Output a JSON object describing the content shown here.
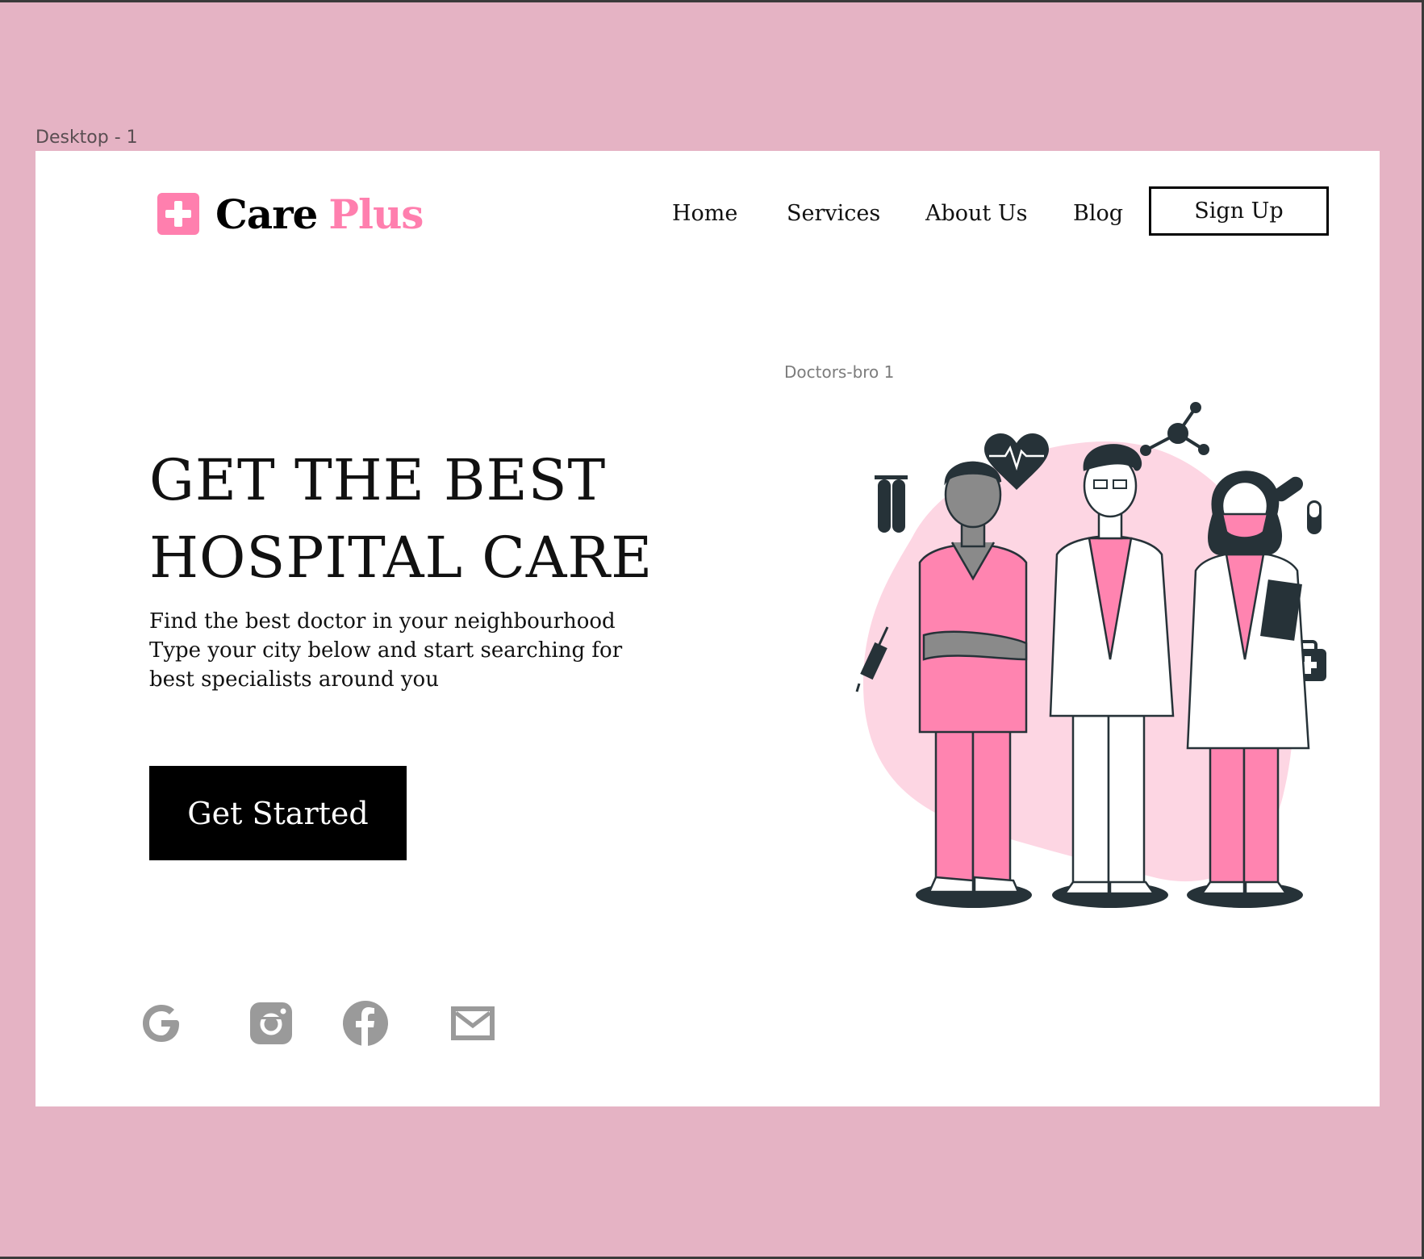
{
  "canvas": {
    "frame_label": "Desktop - 1",
    "illustration_label": "Doctors-bro 1"
  },
  "header": {
    "brand": {
      "name": "Care",
      "accent": "Plus"
    },
    "nav": [
      {
        "label": "Home"
      },
      {
        "label": "Services"
      },
      {
        "label": "About Us"
      },
      {
        "label": "Blog"
      }
    ],
    "signup_label": "Sign Up"
  },
  "hero": {
    "title_lines": [
      "GET THE BEST",
      "HOSPITAL CARE"
    ],
    "subtitle_lines": [
      "Find the best doctor in your neighbourhood",
      "Type your city below and start searching for",
      "best specialists around you"
    ],
    "cta_label": "Get Started"
  },
  "social": [
    {
      "icon": "google-icon"
    },
    {
      "icon": "instagram-icon"
    },
    {
      "icon": "facebook-icon"
    },
    {
      "icon": "mail-icon"
    }
  ],
  "colors": {
    "brand_pink": "#ff7fae",
    "canvas_bg": "#e5b3c4",
    "blob_pink": "#fdd6e3",
    "ink": "#263238",
    "icon_gray": "#9a9a9a"
  }
}
